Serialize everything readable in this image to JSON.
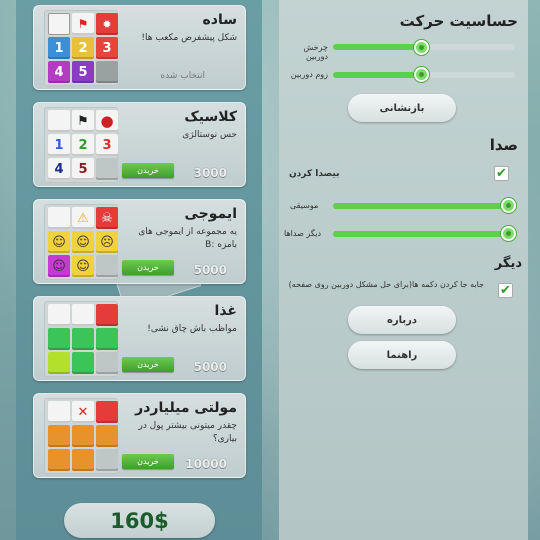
{
  "themes": [
    {
      "title": "ساده",
      "desc": "شکل پیشفرض مکعب ها!",
      "status": "انتخاب شده",
      "buy": "",
      "price": ""
    },
    {
      "title": "کلاسیک",
      "desc": "حس نوستالژی",
      "status": "",
      "buy": "خریدن",
      "price": "3000"
    },
    {
      "title": "ایموجی",
      "desc": "یه مجموعه از ایموجی های بامزه :B",
      "status": "",
      "buy": "خریدن",
      "price": "5000"
    },
    {
      "title": "غذا",
      "desc": "مواظب باش چاق نشی!",
      "status": "",
      "buy": "خریدن",
      "price": "5000"
    },
    {
      "title": "مولتی میلیاردر",
      "desc": "چقدر میتونی بیشتر پول در بیاری؟",
      "status": "",
      "buy": "خریدن",
      "price": "10000"
    }
  ],
  "money": "160$",
  "settings": {
    "motion_heading": "حساسیت حرکت",
    "rotate_label": "چرخش دوربین",
    "zoom_label": "زوم دوربین",
    "rotate_value": 0.45,
    "zoom_value": 0.45,
    "reset_label": "بازنشانی",
    "sound_heading": "صدا",
    "mute_label": "بیصدا کردن",
    "music_label": "موسیقی",
    "fx_label": "دیگر صداها",
    "music_value": 1.0,
    "fx_value": 1.0,
    "other_heading": "دیگر",
    "move_label": "جابه جا کردن دکمه ها(برای حل مشکل دوربین روی صفحه)",
    "about_label": "درباره",
    "help_label": "راهنما"
  },
  "icons": [
    "flag-icon",
    "mine-icon",
    "warning-icon",
    "skull-icon",
    "check-icon"
  ],
  "colors": {
    "green": "#5ecf4a",
    "money": "#1c5b2b"
  }
}
